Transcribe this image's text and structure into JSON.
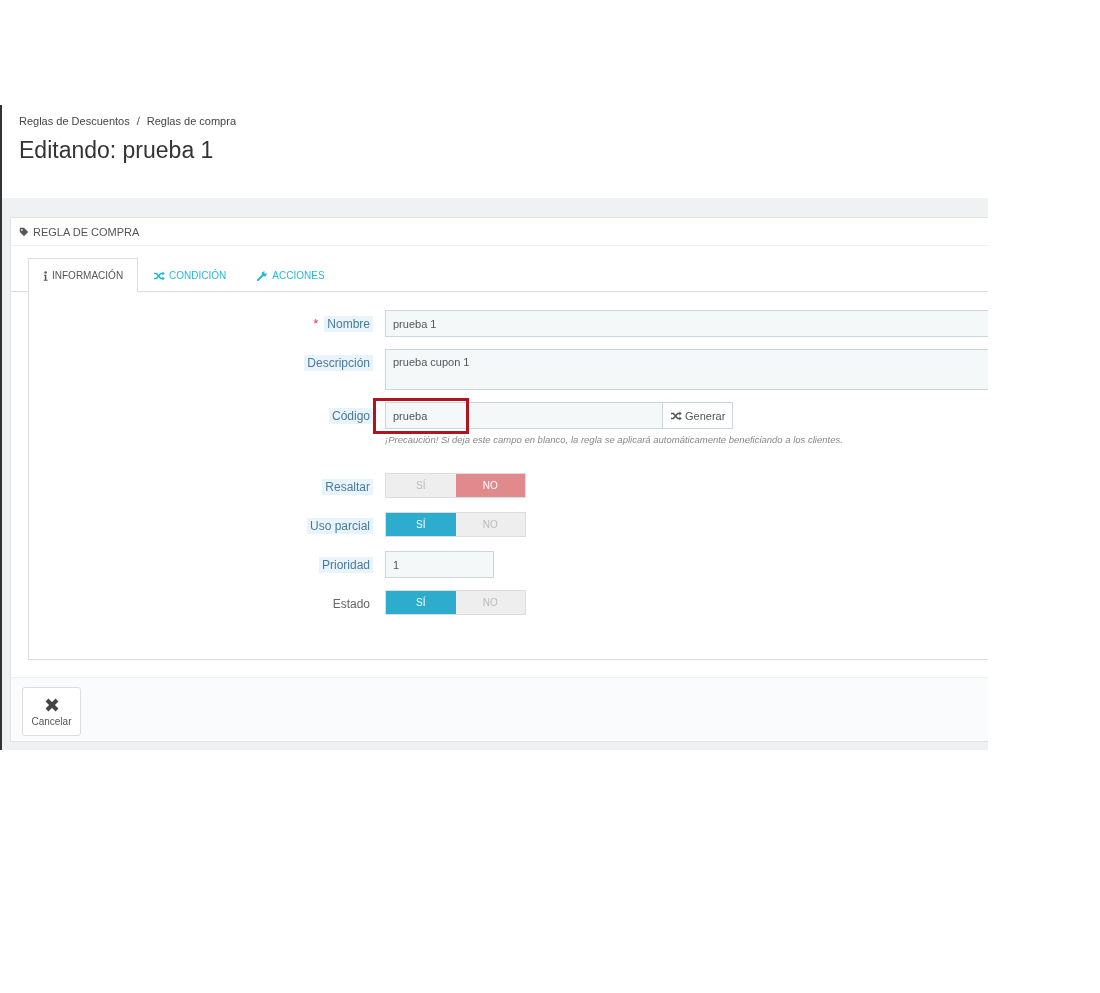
{
  "breadcrumb": {
    "items": [
      "Reglas de Descuentos",
      "Reglas de compra"
    ],
    "separator": "/"
  },
  "page_title": "Editando: prueba 1",
  "panel": {
    "title": "REGLA DE COMPRA",
    "tabs": [
      {
        "label": "INFORMACIÓN",
        "selected": true
      },
      {
        "label": "CONDICIÓN",
        "selected": false
      },
      {
        "label": "ACCIONES",
        "selected": false
      }
    ],
    "fields": [
      {
        "kind": "text",
        "label": "Nombre",
        "required_mark": "*",
        "hint": true,
        "value": "prueba 1"
      },
      {
        "kind": "textarea",
        "label": "Descripción",
        "hint": true,
        "value": "prueba cupon 1"
      },
      {
        "kind": "code",
        "label": "Código",
        "hint": true,
        "value": "prueba",
        "highlighted": true,
        "button": "Generar",
        "help": "¡Precaución! Si deja este campo en blanco, la regla se aplicará automáticamente beneficiando a los clientes."
      },
      {
        "kind": "switch",
        "label": "Resaltar",
        "hint": true,
        "options": [
          {
            "label": "SÍ",
            "selected": false
          },
          {
            "label": "NO",
            "selected": true
          }
        ]
      },
      {
        "kind": "switch",
        "label": "Uso parcial",
        "hint": true,
        "options": [
          {
            "label": "SÍ",
            "selected": true
          },
          {
            "label": "NO",
            "selected": false
          }
        ]
      },
      {
        "kind": "short",
        "label": "Prioridad",
        "hint": true,
        "value": "1"
      },
      {
        "kind": "switch",
        "label": "Estado",
        "hint": false,
        "options": [
          {
            "label": "SÍ",
            "selected": true
          },
          {
            "label": "NO",
            "selected": false
          }
        ]
      }
    ],
    "footer_button": "Cancelar"
  }
}
